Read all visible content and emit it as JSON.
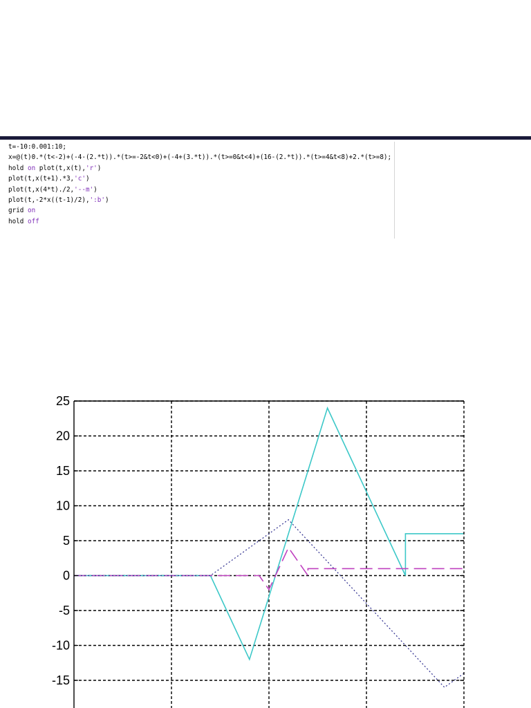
{
  "code": {
    "lines": [
      [
        {
          "t": "t=-10:0.001:10;",
          "k": false
        }
      ],
      [
        {
          "t": "x=@(t)0.*(t<-2)+(-4-(2.*t)).*(t>=-2&t<0)+(-4+(3.*t)).*(t>=0&t<4)+(16-(2.*t)).*(t>=4&t<8)+2.*(t>=8);",
          "k": false
        }
      ],
      [
        {
          "t": "hold ",
          "k": false
        },
        {
          "t": "on",
          "k": true
        },
        {
          "t": " plot(t,x(t),",
          "k": false
        },
        {
          "t": "'r'",
          "k": true
        },
        {
          "t": ")",
          "k": false
        }
      ],
      [
        {
          "t": "plot(t,x(t+1).*3,",
          "k": false
        },
        {
          "t": "'c'",
          "k": true
        },
        {
          "t": ")",
          "k": false
        }
      ],
      [
        {
          "t": "plot(t,x(4*t)./2,",
          "k": false
        },
        {
          "t": "'--m'",
          "k": true
        },
        {
          "t": ")",
          "k": false
        }
      ],
      [
        {
          "t": "plot(t,-2*x((t-1)/2),",
          "k": false
        },
        {
          "t": "':b'",
          "k": true
        },
        {
          "t": ")",
          "k": false
        }
      ],
      [
        {
          "t": "grid ",
          "k": false
        },
        {
          "t": "on",
          "k": true
        }
      ],
      [
        {
          "t": "hold ",
          "k": false
        },
        {
          "t": "off",
          "k": true
        }
      ]
    ]
  },
  "colors": {
    "code_keyword": "#7f2fb8",
    "cyan_series": "#3cc8c8",
    "magenta_series": "#bf40bf",
    "blue_series": "#2a2a8c",
    "grid": "#000000",
    "top_bar": "#1b1b3a"
  },
  "chart_data": {
    "type": "line",
    "title": "",
    "xlabel": "",
    "ylabel": "",
    "xlim": [
      -10,
      10
    ],
    "ylim": [
      -20,
      25
    ],
    "yticks": [
      25,
      20,
      15,
      10,
      5,
      0,
      -5,
      -10,
      -15
    ],
    "ytick_labels": [
      "25",
      "20",
      "15",
      "10",
      "5",
      "0",
      "-5",
      "-10",
      "-15"
    ],
    "xgrid": [
      -5,
      0,
      5,
      10
    ],
    "grid": true,
    "series": [
      {
        "style": "solid",
        "color": "cyan",
        "points": [
          [
            -10,
            0
          ],
          [
            -3,
            0
          ],
          [
            -1,
            -12
          ],
          [
            3,
            24
          ],
          [
            7,
            0
          ],
          [
            7,
            6
          ],
          [
            10,
            6
          ]
        ]
      },
      {
        "style": "dashed",
        "color": "magenta",
        "points": [
          [
            -10,
            0
          ],
          [
            -0.5,
            0
          ],
          [
            0,
            -2
          ],
          [
            1,
            4
          ],
          [
            2,
            0
          ],
          [
            2,
            1
          ],
          [
            10,
            1
          ]
        ]
      },
      {
        "style": "dotted",
        "color": "blue",
        "points": [
          [
            -10,
            0
          ],
          [
            -3,
            0
          ],
          [
            1,
            8
          ],
          [
            9,
            -16
          ],
          [
            10,
            -14
          ]
        ]
      }
    ]
  }
}
